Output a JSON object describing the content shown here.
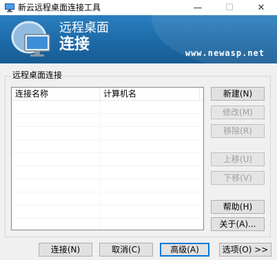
{
  "window": {
    "title": "新云远程桌面连接工具",
    "minimize_glyph": "—",
    "maximize_glyph": "☐",
    "close_glyph": "✕"
  },
  "banner": {
    "line1": "远程桌面",
    "line2": "连接",
    "url": "www.newasp.net",
    "icon": "remote-desktop-monitor-icon"
  },
  "group": {
    "legend": "远程桌面连接"
  },
  "list": {
    "columns": [
      "连接名称",
      "计算机名"
    ],
    "rows": []
  },
  "side_buttons": {
    "new": "新建(N)",
    "edit": "修改(M)",
    "remove": "移除(R)",
    "move_up": "上移(U)",
    "move_down": "下移(V)",
    "help": "帮助(H)",
    "about": "关于(A)..."
  },
  "bottom_buttons": {
    "connect": "连接(N)",
    "cancel": "取消(C)",
    "advanced": "高级(A)",
    "options": "选项(O) >>"
  },
  "colors": {
    "banner": "#1d6aa8",
    "focus_border": "#0078d7"
  }
}
